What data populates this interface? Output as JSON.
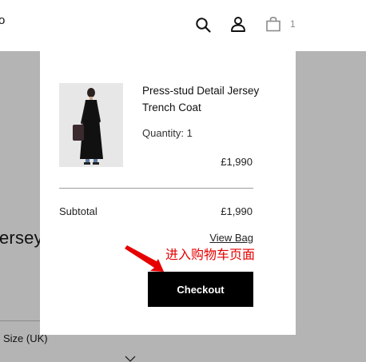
{
  "background_page": {
    "partial_text_top": "o",
    "partial_title": "ersey",
    "size_label": "Size (UK)"
  },
  "header": {
    "icons": [
      "search-icon",
      "account-icon",
      "bag-icon"
    ],
    "bag_count": "1"
  },
  "mini_bag": {
    "item": {
      "name": "Press-stud Detail Jersey Trench Coat",
      "quantity": "Quantity: 1",
      "price": "£1,990"
    },
    "subtotal_label": "Subtotal",
    "subtotal_value": "£1,990",
    "view_bag_label": "View Bag",
    "checkout_label": "Checkout"
  },
  "annotation": {
    "text": "进入购物车页面",
    "color": "#e60000"
  },
  "colors": {
    "overlay": "#b4b4b4",
    "checkout_button": "#000000",
    "bag_count": "#8c8c8c"
  }
}
